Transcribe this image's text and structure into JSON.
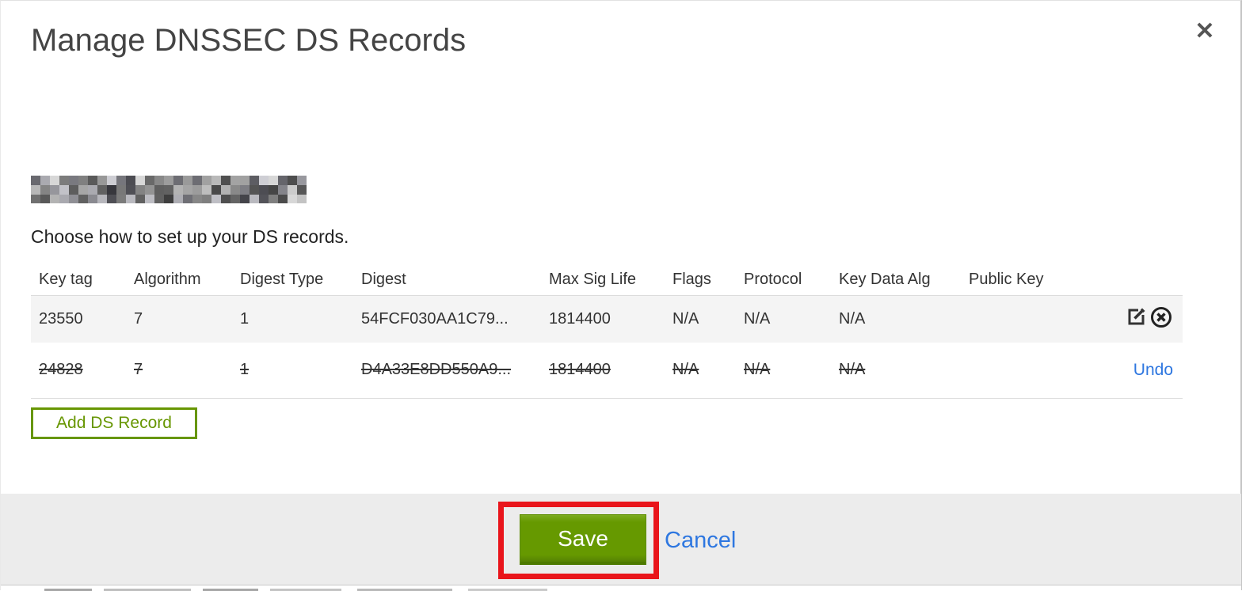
{
  "modal": {
    "title": "Manage DNSSEC DS Records",
    "close_label": "✕",
    "subtitle": "Choose how to set up your DS records.",
    "domain": {
      "redacted": true
    }
  },
  "table": {
    "headers": {
      "key_tag": "Key tag",
      "algorithm": "Algorithm",
      "digest_type": "Digest Type",
      "digest": "Digest",
      "max_sig_life": "Max Sig Life",
      "flags": "Flags",
      "protocol": "Protocol",
      "key_data_alg": "Key Data Alg",
      "public_key": "Public Key"
    },
    "rows": [
      {
        "key_tag": "23550",
        "algorithm": "7",
        "digest_type": "1",
        "digest": "54FCF030AA1C79...",
        "max_sig_life": "1814400",
        "flags": "N/A",
        "protocol": "N/A",
        "key_data_alg": "N/A",
        "public_key": "",
        "state": "normal",
        "actions": [
          "edit",
          "delete"
        ]
      },
      {
        "key_tag": "24828",
        "algorithm": "7",
        "digest_type": "1",
        "digest": "D4A33E8DD550A9...",
        "max_sig_life": "1814400",
        "flags": "N/A",
        "protocol": "N/A",
        "key_data_alg": "N/A",
        "public_key": "",
        "state": "deleted",
        "undo_label": "Undo"
      }
    ]
  },
  "buttons": {
    "add_ds_record": "Add DS Record",
    "save": "Save",
    "cancel": "Cancel"
  },
  "colors": {
    "brand_green": "#669900",
    "link_blue": "#2e77e0",
    "annotation_red": "#e9151b",
    "row_stripe": "#f4f4f4",
    "footer_gray": "#ececec"
  }
}
